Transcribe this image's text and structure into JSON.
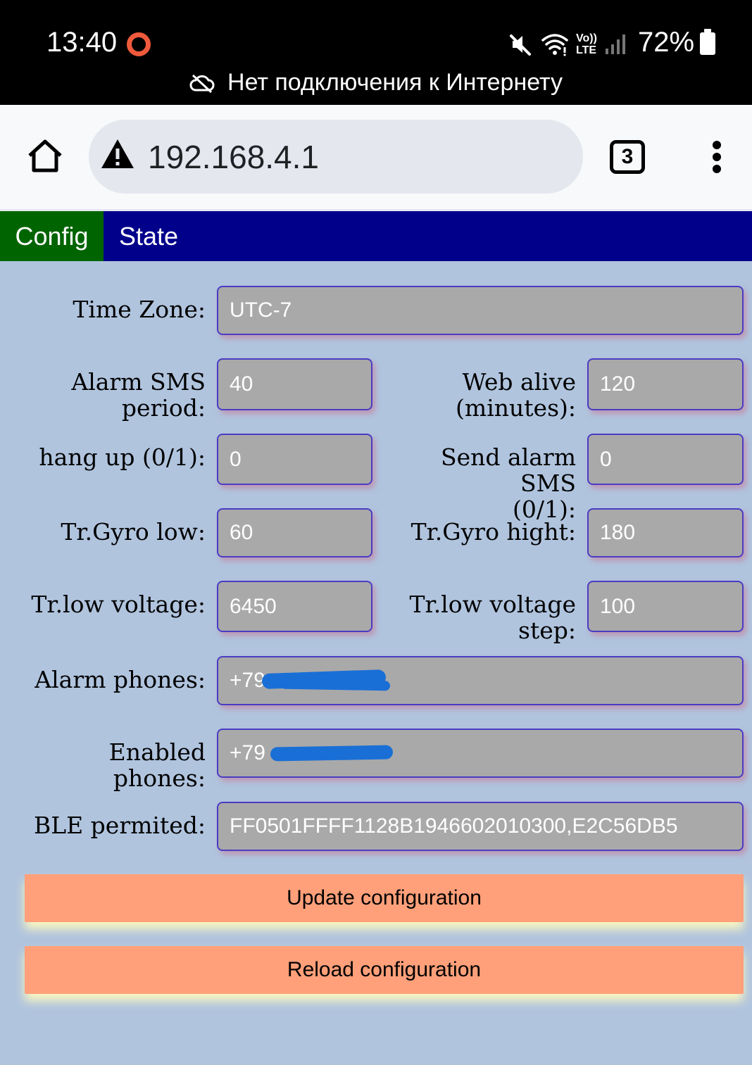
{
  "status_bar": {
    "time": "13:40",
    "battery": "72%",
    "network_label_top": "Vo))",
    "network_label_bottom": "LTE",
    "connectivity_message": "Нет подключения к Интернету"
  },
  "browser": {
    "url": "192.168.4.1",
    "tab_count": "3"
  },
  "tabs": [
    {
      "label": "Config",
      "active": true
    },
    {
      "label": "State",
      "active": false
    }
  ],
  "form": {
    "time_zone": {
      "label": "Time Zone:",
      "value": "UTC-7"
    },
    "alarm_sms_period": {
      "label_line1": "Alarm SMS",
      "label_line2": "period:",
      "value": "40"
    },
    "web_alive": {
      "label_line1": "Web alive",
      "label_line2": "(minutes):",
      "value": "120"
    },
    "hang_up": {
      "label": "hang up (0/1):",
      "value": "0"
    },
    "send_alarm_sms": {
      "label_line1": "Send alarm SMS",
      "label_line2": "(0/1):",
      "value": "0"
    },
    "tr_gyro_low": {
      "label": "Tr.Gyro low:",
      "value": "60"
    },
    "tr_gyro_hight": {
      "label": "Tr.Gyro hight:",
      "value": "180"
    },
    "tr_low_voltage": {
      "label": "Tr.low voltage:",
      "value": "6450"
    },
    "tr_low_voltage_step": {
      "label_line1": "Tr.low voltage",
      "label_line2": "step:",
      "value": "100"
    },
    "alarm_phones": {
      "label": "Alarm phones:",
      "value": "+79"
    },
    "enabled_phones": {
      "label": "Enabled phones:",
      "value": "+79"
    },
    "ble_permited": {
      "label": "BLE permited:",
      "value": "FF0501FFFF1128B1946602010300,E2C56DB5"
    }
  },
  "buttons": {
    "update": "Update configuration",
    "reload": "Reload configuration"
  },
  "colors": {
    "page_bg": "#b0c4de",
    "tab_bar_bg": "#00008b",
    "active_tab_bg": "#006400",
    "field_bg": "#a9a9a9",
    "button_bg": "#ffa07a",
    "redaction": "#1a6fd6"
  },
  "icons": [
    "recording-icon",
    "mute-icon",
    "wifi-icon",
    "signal-icon",
    "battery-icon",
    "cloud-off-icon",
    "home-icon",
    "warning-icon",
    "tabs-icon",
    "more-vert-icon"
  ]
}
